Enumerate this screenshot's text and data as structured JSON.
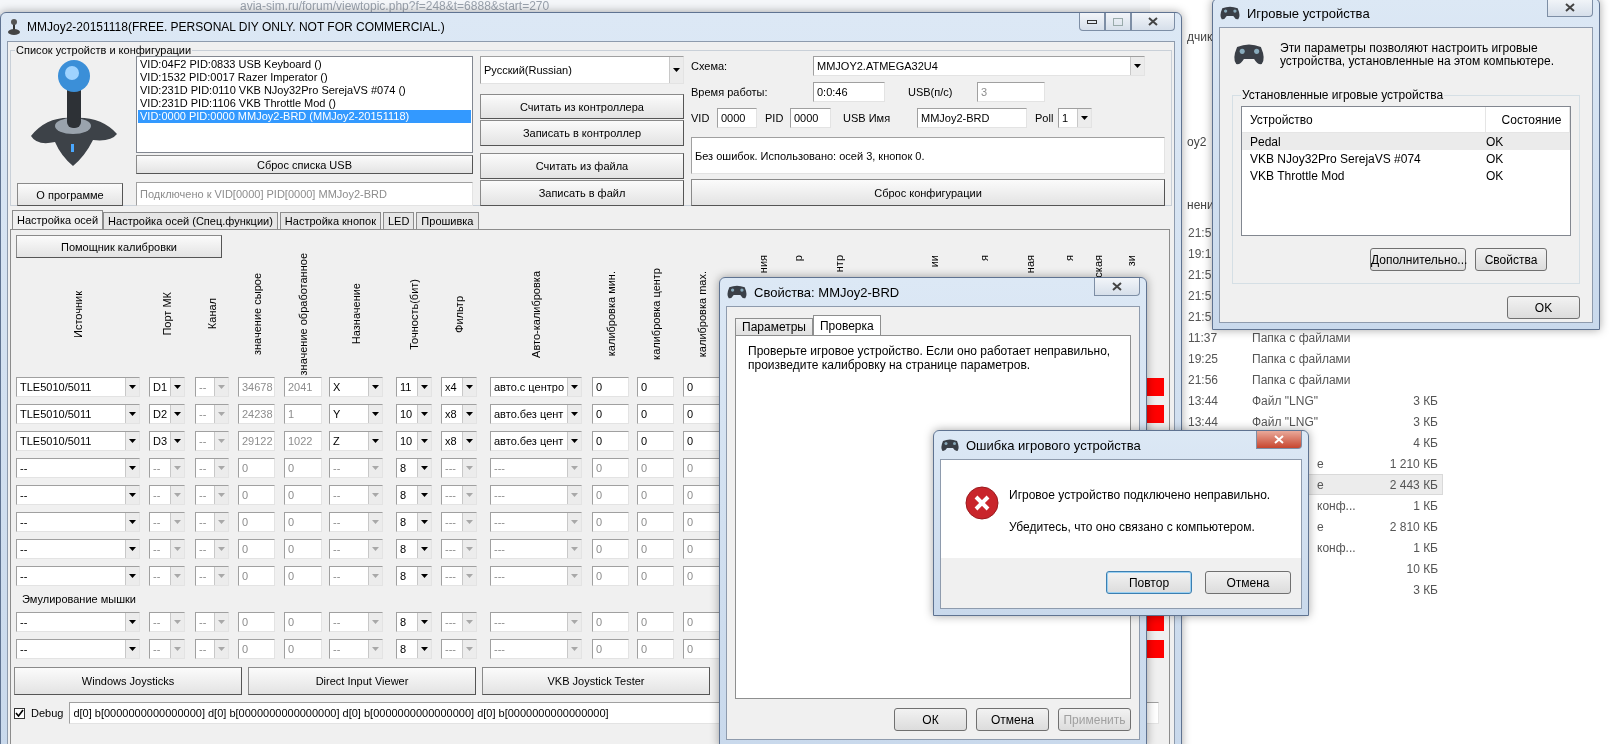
{
  "browser": {
    "address": "avia-sim.ru/forum/viewtopic.php?f=248&t=6888&start=270"
  },
  "explorer": {
    "fragments": [
      "дчик",
      "oy2",
      "нени"
    ],
    "files": [
      {
        "kind": "under_window",
        "time": "21:5",
        "selected": false
      },
      {
        "kind": "under_window",
        "time": "19:1",
        "selected": false
      },
      {
        "kind": "under_window",
        "time": "21:5",
        "selected": false
      },
      {
        "kind": "under_window",
        "time": "21:5",
        "selected": false
      },
      {
        "kind": "under_window",
        "time": "21:5",
        "selected": false
      },
      {
        "kind": "full",
        "time": "11:37",
        "type": "Папка с файлами",
        "selected": false
      },
      {
        "kind": "full",
        "time": "19:25",
        "type": "Папка с файлами",
        "selected": false
      },
      {
        "kind": "full",
        "time": "21:56",
        "type": "Папка с файлами",
        "selected": false
      },
      {
        "kind": "full",
        "time": "13:44",
        "type": "Файл \"LNG\"",
        "size": "3 КБ",
        "selected": false
      },
      {
        "kind": "full",
        "time": "13:44",
        "type": "Файл \"LNG\"",
        "size": "3 КБ",
        "selected": false
      },
      {
        "kind": "under_dialog",
        "size": "4 КБ",
        "selected": false
      },
      {
        "kind": "under_dialog",
        "type": "е",
        "size": "1 210 КБ",
        "selected": false
      },
      {
        "kind": "under_dialog",
        "type": "е",
        "size": "2 443 КБ",
        "selected": true
      },
      {
        "kind": "under_dialog",
        "type": "конф...",
        "size": "1 КБ",
        "selected": false
      },
      {
        "kind": "under_dialog",
        "type": "е",
        "size": "2 810 КБ",
        "selected": false
      },
      {
        "kind": "under_dialog",
        "type": "конф...",
        "size": "1 КБ",
        "selected": false
      },
      {
        "kind": "under_dialog",
        "size": "10 КБ",
        "selected": false
      },
      {
        "kind": "under_dialog",
        "size": "3 КБ",
        "selected": false
      }
    ]
  },
  "main_window": {
    "title": "MMJoy2-20151118(FREE. PERSONAL DIY ONLY. NOT FOR COMMERCIAL.)",
    "group_label": "Список устройств и конфигурации",
    "devices": [
      {
        "label": "VID:04F2 PID:0833 USB Keyboard ()",
        "selected": false
      },
      {
        "label": "VID:1532 PID:0017 Razer Imperator ()",
        "selected": false
      },
      {
        "label": "VID:231D PID:0110 VKB NJoy32Pro SerejaVS #074  ()",
        "selected": false
      },
      {
        "label": "VID:231D PID:1106 VKB Throttle Mod ()",
        "selected": false
      },
      {
        "label": "VID:0000 PID:0000 MMJoy2-BRD (MMJoy2-20151118)",
        "selected": true
      }
    ],
    "reset_usb_button": "Сброс списка USB",
    "about_button": "О программе",
    "connected_field": {
      "value": "Подключено к VID[0000] PID[0000] MMJoy2-BRD",
      "disabled": true
    },
    "language": "Русский(Russian)",
    "action_buttons": [
      "Считать из контроллера",
      "Записать в контроллер",
      "Считать из файла",
      "Записать в файл"
    ],
    "scheme": {
      "label": "Схема:",
      "value": "MMJOY2.ATMEGA32U4"
    },
    "uptime": {
      "label": "Время работы:",
      "value": "0:0:46"
    },
    "usb_rate": {
      "label": "USB(п/с)",
      "value": "3",
      "disabled": true
    },
    "vid": {
      "label": "VID",
      "value": "0000"
    },
    "pid": {
      "label": "PID",
      "value": "0000"
    },
    "usb_name": {
      "label": "USB Имя",
      "value": "MMJoy2-BRD"
    },
    "poll": {
      "label": "Poll",
      "value": "1"
    },
    "status": "Без ошибок. Использовано: осей  3, кнопок  0.",
    "reset_config_button": "Сброс конфигурации",
    "tabs": [
      {
        "label": "Настройка осей",
        "selected": true
      },
      {
        "label": "Настройка осей (Спец.функции)",
        "selected": false
      },
      {
        "label": "Настройка кнопок",
        "selected": false
      },
      {
        "label": "LED",
        "selected": false
      },
      {
        "label": "Прошивка",
        "selected": false
      }
    ],
    "calibration_button": "Помощник калибровки",
    "columns": [
      {
        "label": "Источник",
        "kind": "combo"
      },
      {
        "label": "Порт МК",
        "kind": "combo"
      },
      {
        "label": "Канал",
        "kind": "combo"
      },
      {
        "label": "значение сырое",
        "kind": "field"
      },
      {
        "label": "значение обработанное",
        "kind": "field"
      },
      {
        "label": "Назначение",
        "kind": "combo"
      },
      {
        "label": "Точность(бит)",
        "kind": "combo"
      },
      {
        "label": "Фильтр",
        "kind": "combo"
      },
      {
        "label": "Авто-калибровка",
        "kind": "combo"
      },
      {
        "label": "калибровка мин.",
        "kind": "field"
      },
      {
        "label": "калибровка центр",
        "kind": "field"
      },
      {
        "label": "калибровка max.",
        "kind": "field"
      }
    ],
    "column_fragments": [
      "ния",
      "р",
      "нтр",
      "ии",
      "я",
      "ная",
      "я",
      "ская",
      "зи"
    ],
    "rows": [
      {
        "alarm": true,
        "cells": [
          {
            "value": "TLE5010/5011",
            "disabled": false
          },
          {
            "value": "D1",
            "disabled": false
          },
          {
            "value": "--",
            "disabled": true
          },
          {
            "value": "34678",
            "disabled": true
          },
          {
            "value": "2041",
            "disabled": true
          },
          {
            "value": "X",
            "disabled": false
          },
          {
            "value": "11",
            "disabled": false
          },
          {
            "value": "x4",
            "disabled": false
          },
          {
            "value": "авто.с центро",
            "disabled": false
          },
          {
            "value": "0",
            "disabled": false
          },
          {
            "value": "0",
            "disabled": false
          },
          {
            "value": "0",
            "disabled": false
          }
        ]
      },
      {
        "alarm": true,
        "cells": [
          {
            "value": "TLE5010/5011",
            "disabled": false
          },
          {
            "value": "D2",
            "disabled": false
          },
          {
            "value": "--",
            "disabled": true
          },
          {
            "value": "24238",
            "disabled": true
          },
          {
            "value": "1",
            "disabled": true
          },
          {
            "value": "Y",
            "disabled": false
          },
          {
            "value": "10",
            "disabled": false
          },
          {
            "value": "x8",
            "disabled": false
          },
          {
            "value": "авто.без цент",
            "disabled": false
          },
          {
            "value": "0",
            "disabled": false
          },
          {
            "value": "0",
            "disabled": false
          },
          {
            "value": "0",
            "disabled": false
          }
        ]
      },
      {
        "cells": [
          {
            "value": "TLE5010/5011",
            "disabled": false
          },
          {
            "value": "D3",
            "disabled": false
          },
          {
            "value": "--",
            "disabled": true
          },
          {
            "value": "29122",
            "disabled": true
          },
          {
            "value": "1022",
            "disabled": true
          },
          {
            "value": "Z",
            "disabled": false
          },
          {
            "value": "10",
            "disabled": false
          },
          {
            "value": "x8",
            "disabled": false
          },
          {
            "value": "авто.без цент",
            "disabled": false
          },
          {
            "value": "0",
            "disabled": false
          },
          {
            "value": "0",
            "disabled": false
          },
          {
            "value": "0",
            "disabled": false
          }
        ]
      },
      {
        "cells": [
          {
            "value": "--",
            "disabled": false
          },
          {
            "value": "--",
            "disabled": true
          },
          {
            "value": "--",
            "disabled": true
          },
          {
            "value": "0",
            "disabled": true
          },
          {
            "value": "0",
            "disabled": true
          },
          {
            "value": "--",
            "disabled": true
          },
          {
            "value": "8",
            "disabled": false
          },
          {
            "value": "---",
            "disabled": true
          },
          {
            "value": "---",
            "disabled": true
          },
          {
            "value": "0",
            "disabled": true
          },
          {
            "value": "0",
            "disabled": true
          },
          {
            "value": "0",
            "disabled": true
          }
        ]
      },
      {
        "cells": [
          {
            "value": "--",
            "disabled": false
          },
          {
            "value": "--",
            "disabled": true
          },
          {
            "value": "--",
            "disabled": true
          },
          {
            "value": "0",
            "disabled": true
          },
          {
            "value": "0",
            "disabled": true
          },
          {
            "value": "--",
            "disabled": true
          },
          {
            "value": "8",
            "disabled": false
          },
          {
            "value": "---",
            "disabled": true
          },
          {
            "value": "---",
            "disabled": true
          },
          {
            "value": "0",
            "disabled": true
          },
          {
            "value": "0",
            "disabled": true
          },
          {
            "value": "0",
            "disabled": true
          }
        ]
      },
      {
        "cells": [
          {
            "value": "--",
            "disabled": false
          },
          {
            "value": "--",
            "disabled": true
          },
          {
            "value": "--",
            "disabled": true
          },
          {
            "value": "0",
            "disabled": true
          },
          {
            "value": "0",
            "disabled": true
          },
          {
            "value": "--",
            "disabled": true
          },
          {
            "value": "8",
            "disabled": false
          },
          {
            "value": "---",
            "disabled": true
          },
          {
            "value": "---",
            "disabled": true
          },
          {
            "value": "0",
            "disabled": true
          },
          {
            "value": "0",
            "disabled": true
          },
          {
            "value": "0",
            "disabled": true
          }
        ]
      },
      {
        "cells": [
          {
            "value": "--",
            "disabled": false
          },
          {
            "value": "--",
            "disabled": true
          },
          {
            "value": "--",
            "disabled": true
          },
          {
            "value": "0",
            "disabled": true
          },
          {
            "value": "0",
            "disabled": true
          },
          {
            "value": "--",
            "disabled": true
          },
          {
            "value": "8",
            "disabled": false
          },
          {
            "value": "---",
            "disabled": true
          },
          {
            "value": "---",
            "disabled": true
          },
          {
            "value": "0",
            "disabled": true
          },
          {
            "value": "0",
            "disabled": true
          },
          {
            "value": "0",
            "disabled": true
          }
        ]
      },
      {
        "cells": [
          {
            "value": "--",
            "disabled": false
          },
          {
            "value": "--",
            "disabled": true
          },
          {
            "value": "--",
            "disabled": true
          },
          {
            "value": "0",
            "disabled": true
          },
          {
            "value": "0",
            "disabled": true
          },
          {
            "value": "--",
            "disabled": true
          },
          {
            "value": "8",
            "disabled": false
          },
          {
            "value": "---",
            "disabled": true
          },
          {
            "value": "---",
            "disabled": true
          },
          {
            "value": "0",
            "disabled": true
          },
          {
            "value": "0",
            "disabled": true
          },
          {
            "value": "0",
            "disabled": true
          }
        ]
      }
    ],
    "mouse_label": "Эмулирование мышки",
    "mouse_rows": [
      {
        "alarm": true,
        "cells": [
          {
            "value": "--",
            "disabled": false
          },
          {
            "value": "--",
            "disabled": true
          },
          {
            "value": "--",
            "disabled": true
          },
          {
            "value": "0",
            "disabled": true
          },
          {
            "value": "0",
            "disabled": true
          },
          {
            "value": "--",
            "disabled": true
          },
          {
            "value": "8",
            "disabled": false
          },
          {
            "value": "---",
            "disabled": true
          },
          {
            "value": "---",
            "disabled": true
          },
          {
            "value": "0",
            "disabled": true
          },
          {
            "value": "0",
            "disabled": true
          },
          {
            "value": "0",
            "disabled": true
          }
        ]
      },
      {
        "alarm": true,
        "cells": [
          {
            "value": "--",
            "disabled": false
          },
          {
            "value": "--",
            "disabled": true
          },
          {
            "value": "--",
            "disabled": true
          },
          {
            "value": "0",
            "disabled": true
          },
          {
            "value": "0",
            "disabled": true
          },
          {
            "value": "--",
            "disabled": true
          },
          {
            "value": "8",
            "disabled": false
          },
          {
            "value": "---",
            "disabled": true
          },
          {
            "value": "---",
            "disabled": true
          },
          {
            "value": "0",
            "disabled": true
          },
          {
            "value": "0",
            "disabled": true
          },
          {
            "value": "0",
            "disabled": true
          }
        ]
      }
    ],
    "bottom_buttons": [
      "Windows Joysticks",
      "Direct Input Viewer",
      "VKB Joystick Tester"
    ],
    "debug": {
      "label": "Debug",
      "checked": true,
      "value": "d[0] b[0000000000000000]   d[0] b[0000000000000000]   d[0] b[0000000000000000]   d[0] b[0000000000000000]"
    }
  },
  "game_devices": {
    "title": "Игровые устройства",
    "intro": "Эти параметры позволяют настроить игровые устройства, установленные на этом компьютере.",
    "group_label": "Установленные игровые устройства",
    "columns": [
      "Устройство",
      "Состояние"
    ],
    "devices": [
      {
        "name": "Pedal",
        "status": "OK",
        "selected": true
      },
      {
        "name": "VKB NJoy32Pro SerejaVS #074",
        "status": "OK",
        "selected": false
      },
      {
        "name": "VKB Throttle Mod",
        "status": "OK",
        "selected": false
      }
    ],
    "buttons": [
      "Дополнительно...",
      "Свойства"
    ],
    "ok": "OK"
  },
  "properties": {
    "title": "Свойства: MMJoy2-BRD",
    "tabs": [
      {
        "label": "Параметры",
        "selected": false
      },
      {
        "label": "Проверка",
        "selected": true
      }
    ],
    "text": "Проверьте игровое устройство. Если оно работает неправильно, произведите калибровку на странице параметров.",
    "buttons": [
      {
        "label": "ОК",
        "disabled": false
      },
      {
        "label": "Отмена",
        "disabled": false
      },
      {
        "label": "Применить",
        "disabled": true
      }
    ]
  },
  "error": {
    "title": "Ошибка игрового устройства",
    "message": "Игровое устройство подключено неправильно.",
    "hint": "Убедитесь, что оно связано с компьютером.",
    "buttons": [
      {
        "label": "Повтор",
        "default": true
      },
      {
        "label": "Отмена",
        "default": false
      }
    ]
  }
}
